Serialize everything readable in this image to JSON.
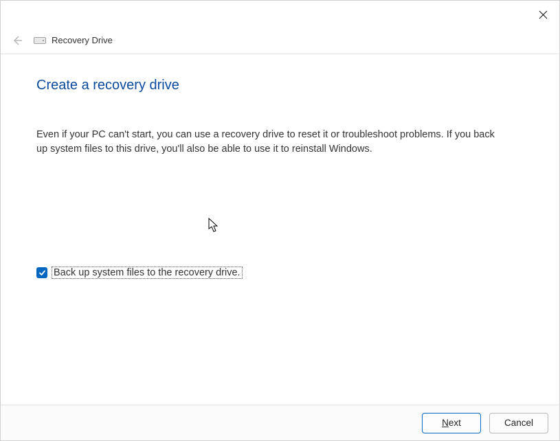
{
  "window": {
    "title": "Recovery Drive"
  },
  "page": {
    "heading": "Create a recovery drive",
    "description": "Even if your PC can't start, you can use a recovery drive to reset it or troubleshoot problems. If you back up system files to this drive, you'll also be able to use it to reinstall Windows."
  },
  "checkbox": {
    "label": "Back up system files to the recovery drive.",
    "checked": true
  },
  "footer": {
    "next_rest": "ext",
    "cancel": "Cancel"
  }
}
